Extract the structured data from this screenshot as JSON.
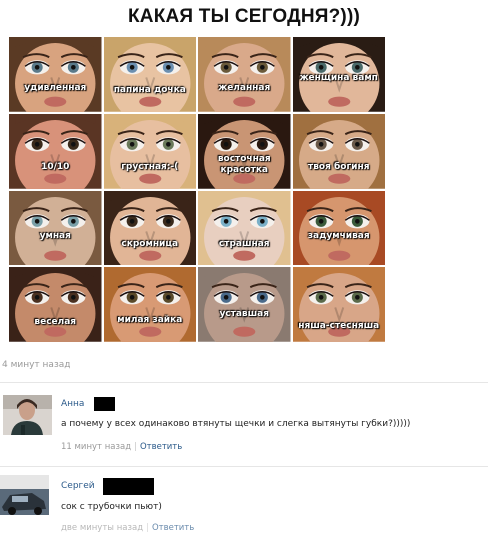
{
  "post": {
    "title": "КАКАЯ ТЫ СЕГОДНЯ?)))",
    "timestamp": "4 минут назад"
  },
  "grid": [
    {
      "caption": "удивленная",
      "skin": "#d8a37f",
      "hair": "#5a3a24",
      "iris": "#5a7a8a"
    },
    {
      "caption": "папина дочка",
      "skin": "#e8c3a2",
      "hair": "#c9a46a",
      "iris": "#6b8fb0"
    },
    {
      "caption": "желанная",
      "skin": "#d9a98a",
      "hair": "#b88a5a",
      "iris": "#6a5a3a"
    },
    {
      "caption": "женщина вамп",
      "skin": "#e1b79a",
      "hair": "#2a1c14",
      "iris": "#4a6a6a"
    },
    {
      "caption": "10/10",
      "skin": "#d8927a",
      "hair": "#5a3524",
      "iris": "#3a2a1a"
    },
    {
      "caption": "грустная:-(",
      "skin": "#e7bfa0",
      "hair": "#d8b27a",
      "iris": "#6a7a5a"
    },
    {
      "caption": "восточная красотка",
      "skin": "#c99574",
      "hair": "#2a1810",
      "iris": "#2a1a10"
    },
    {
      "caption": "твоя богиня",
      "skin": "#d6aa88",
      "hair": "#a07040",
      "iris": "#6a5a4a"
    },
    {
      "caption": "умная",
      "skin": "#d1b096",
      "hair": "#7a5a40",
      "iris": "#7aa0a8"
    },
    {
      "caption": "скромница",
      "skin": "#e1b596",
      "hair": "#3a2418",
      "iris": "#3a2a1c"
    },
    {
      "caption": "страшная",
      "skin": "#e8cfc0",
      "hair": "#e0c090",
      "iris": "#7ab0c8"
    },
    {
      "caption": "задумчивая",
      "skin": "#d6966e",
      "hair": "#a84a24",
      "iris": "#3a5a3a"
    },
    {
      "caption": "веселая",
      "skin": "#c48a6a",
      "hair": "#3a2218",
      "iris": "#4a3020"
    },
    {
      "caption": "милая зайка",
      "skin": "#d89a74",
      "hair": "#b06a30",
      "iris": "#5a4a2a"
    },
    {
      "caption": "уставшая",
      "skin": "#b89a8a",
      "hair": "#8a7a70",
      "iris": "#4a6a8a"
    },
    {
      "caption": "няша-стесняша",
      "skin": "#d8a688",
      "hair": "#c07a40",
      "iris": "#5a6a4a"
    }
  ],
  "comments": [
    {
      "name": "Анна",
      "text": "а почему у всех одинаково втянуты щечки и слегка вытянуты губки?)))))",
      "time": "11 минут назад",
      "reply": "Ответить"
    },
    {
      "name": "Сергей",
      "text": "сок с трубочки пьют)",
      "time": "две минуты назад",
      "reply": "Ответить"
    }
  ]
}
